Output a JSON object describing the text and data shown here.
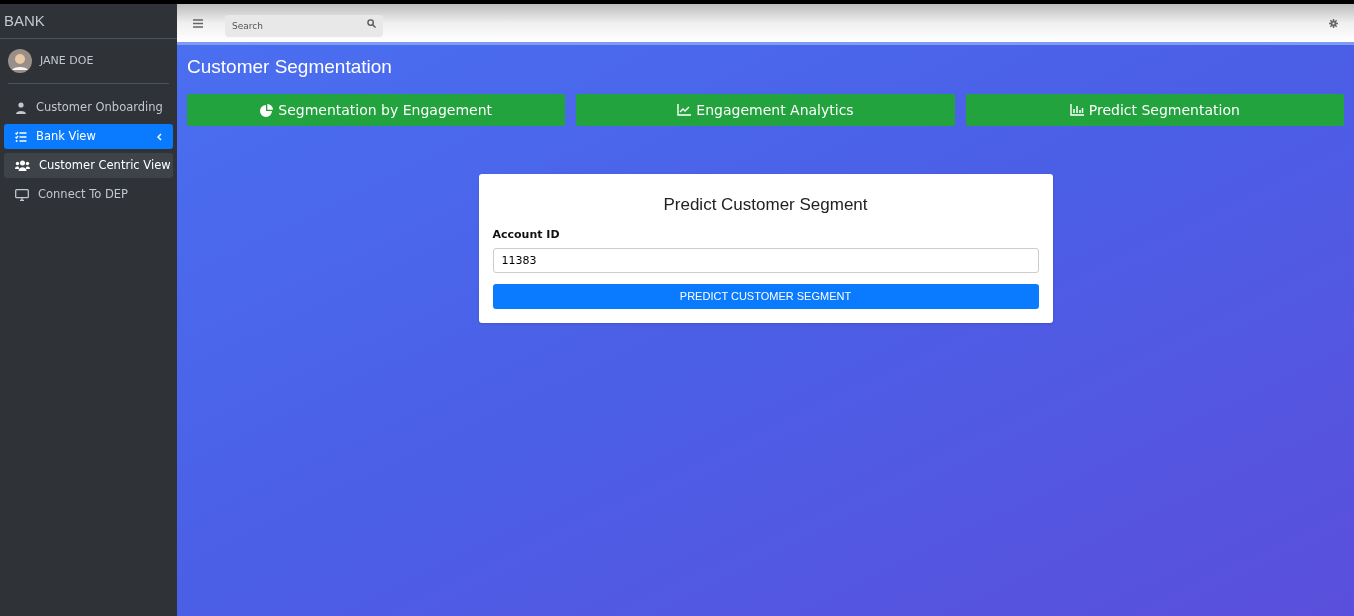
{
  "sidebar": {
    "brand": "BANK",
    "user": {
      "name": "JANE DOE"
    },
    "items": [
      {
        "label": "Customer Onboarding",
        "selected": false,
        "hovered": false,
        "has_submenu": false
      },
      {
        "label": "Bank View",
        "selected": true,
        "hovered": false,
        "has_submenu": true
      },
      {
        "label": "Customer Centric View",
        "selected": false,
        "hovered": true,
        "has_submenu": false
      },
      {
        "label": "Connect To DEP",
        "selected": false,
        "hovered": false,
        "has_submenu": false
      }
    ]
  },
  "header": {
    "search": {
      "placeholder": "Search"
    }
  },
  "page": {
    "title": "Customer Segmentation",
    "tabs": [
      {
        "label": "Segmentation by Engagement"
      },
      {
        "label": "Engagement Analytics"
      },
      {
        "label": "Predict Segmentation"
      }
    ],
    "form": {
      "title": "Predict Customer Segment",
      "field_label": "Account ID",
      "field_value": "11383",
      "submit": "PREDICT CUSTOMER SEGMENT"
    }
  }
}
